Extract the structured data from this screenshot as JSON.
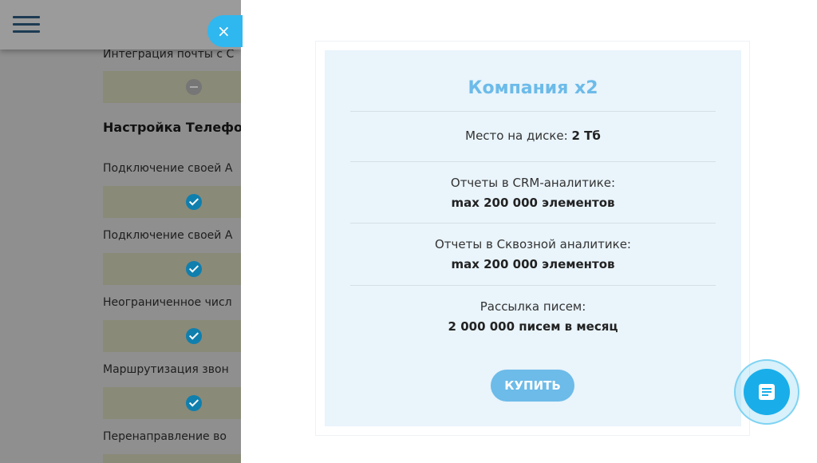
{
  "background": {
    "items": [
      {
        "label": "Интеграция почты с С",
        "mark": "minus"
      },
      {
        "heading": "Настройка Телефо"
      },
      {
        "label": "Подключение своей А",
        "mark": "check"
      },
      {
        "label": "Подключение своей А",
        "mark": "check"
      },
      {
        "label": "Неограниченное числ",
        "mark": "check"
      },
      {
        "label": "Маршрутизация звон",
        "mark": "check"
      },
      {
        "label": "Перенаправление во",
        "mark": "check"
      }
    ]
  },
  "modal": {
    "close_icon": "×",
    "plan": {
      "title": "Компания x2",
      "features": [
        {
          "label": "Место на диске:",
          "value": "2 Тб"
        },
        {
          "label": "Отчеты в CRM-аналитике:",
          "value": "max 200 000 элементов"
        },
        {
          "label": "Отчеты в Сквозной аналитике:",
          "value": "max 200 000 элементов"
        },
        {
          "label": "Рассылка писем:",
          "value": "2 000 000 писем в месяц"
        }
      ],
      "buy_label": "КУПИТЬ"
    }
  },
  "colors": {
    "accent": "#6cbbe9",
    "close_button": "#2fb7ef",
    "chat_button": "#19aee9",
    "card_background": "#e9f4fb"
  },
  "icons": [
    "menu-icon",
    "close-icon",
    "check-icon",
    "minus-icon",
    "chat-icon"
  ]
}
